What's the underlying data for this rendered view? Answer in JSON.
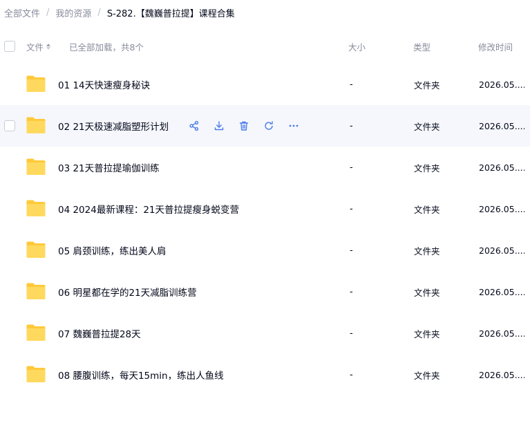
{
  "breadcrumb": {
    "items": [
      "全部文件",
      "我的资源"
    ],
    "separator": "/",
    "current": "S-282.【魏巍普拉提】课程合集"
  },
  "header": {
    "name_label": "文件",
    "loaded_text": "已全部加载，共8个",
    "size_label": "大小",
    "type_label": "类型",
    "time_label": "修改时间"
  },
  "colors": {
    "accent": "#4b7bec",
    "folder": "#ffd34e",
    "hover_row": "#f5f7fc"
  },
  "hover_actions": [
    "share-icon",
    "download-icon",
    "delete-icon",
    "rename-icon",
    "more-icon"
  ],
  "files": [
    {
      "name": "01 14天快速瘦身秘诀",
      "size": "-",
      "type": "文件夹",
      "time": "2026.05...."
    },
    {
      "name": "02 21天极速减脂塑形计划",
      "size": "-",
      "type": "文件夹",
      "time": "2026.05...."
    },
    {
      "name": "03 21天普拉提瑜伽训练",
      "size": "-",
      "type": "文件夹",
      "time": "2026.05...."
    },
    {
      "name": "04 2024最新课程：21天普拉提瘦身蜕变营",
      "size": "-",
      "type": "文件夹",
      "time": "2026.05...."
    },
    {
      "name": "05 肩颈训练，练出美人肩",
      "size": "-",
      "type": "文件夹",
      "time": "2026.05...."
    },
    {
      "name": "06 明星都在学的21天减脂训练营",
      "size": "-",
      "type": "文件夹",
      "time": "2026.05...."
    },
    {
      "name": "07 魏巍普拉提28天",
      "size": "-",
      "type": "文件夹",
      "time": "2026.05...."
    },
    {
      "name": "08 腰腹训练，每天15min，练出人鱼线",
      "size": "-",
      "type": "文件夹",
      "time": "2026.05...."
    }
  ]
}
